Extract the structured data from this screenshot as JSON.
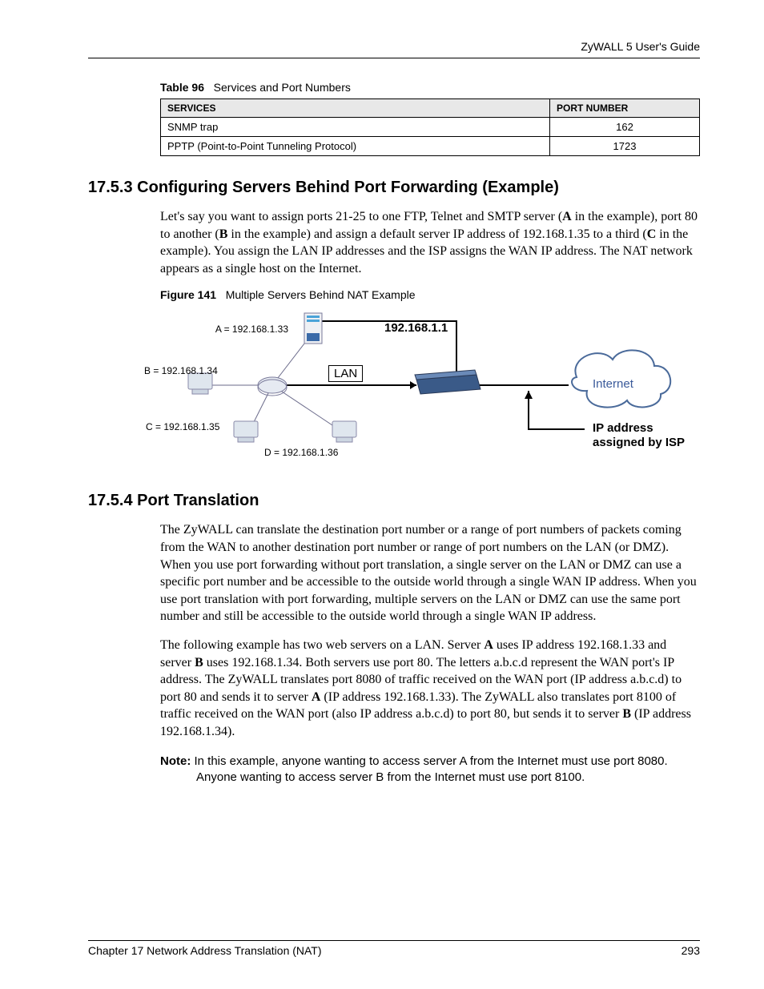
{
  "header": {
    "guide_title": "ZyWALL 5 User's Guide"
  },
  "table96": {
    "caption_label": "Table 96",
    "caption_text": "Services and Port Numbers",
    "columns": {
      "services": "SERVICES",
      "port": "PORT NUMBER"
    },
    "rows": [
      {
        "service": "SNMP trap",
        "port": "162"
      },
      {
        "service": "PPTP (Point-to-Point Tunneling Protocol)",
        "port": "1723"
      }
    ]
  },
  "section_1753": {
    "heading": "17.5.3  Configuring Servers Behind Port Forwarding (Example)",
    "para_parts": {
      "t1": "Let's say you want to assign ports 21-25 to one FTP, Telnet and SMTP server (",
      "A": "A",
      "t2": " in the example), port 80 to another (",
      "B": "B",
      "t3": " in the example) and assign a default server IP address of 192.168.1.35 to a third (",
      "C": "C",
      "t4": " in the example). You assign the LAN IP addresses and the ISP assigns the WAN IP address. The NAT network appears as a single host on the Internet."
    }
  },
  "figure141": {
    "caption_label": "Figure 141",
    "caption_text": "Multiple Servers Behind NAT Example",
    "labels": {
      "A": "A = 192.168.1.33",
      "B": "B = 192.168.1.34",
      "C": "C  = 192.168.1.35",
      "D": "D = 192.168.1.36",
      "gateway": "192.168.1.1",
      "lan": "LAN",
      "internet": "Internet",
      "isp1": "IP address",
      "isp2": "assigned by ISP"
    }
  },
  "section_1754": {
    "heading": "17.5.4  Port Translation",
    "para1": "The ZyWALL can translate the destination port number or a range of port numbers of packets coming from the WAN to another destination port number or range of port numbers on the LAN (or DMZ). When you use port forwarding without port translation, a single server on the LAN or DMZ can use a specific port number and be accessible to the outside world through a single WAN IP address. When you use port translation with port forwarding, multiple servers on the LAN or DMZ can use the same port number and still be accessible to the outside world through a single WAN IP address.",
    "para2_parts": {
      "t1": "The following example has two web servers on a LAN. Server ",
      "A": "A",
      "t2": " uses IP address 192.168.1.33 and server ",
      "B": "B",
      "t3": " uses 192.168.1.34. Both servers use port 80. The letters a.b.c.d represent the WAN port's IP address. The ZyWALL translates port 8080 of traffic received on the WAN port (IP address a.b.c.d) to port 80 and sends it to server ",
      "A2": "A",
      "t4": " (IP address 192.168.1.33). The ZyWALL also translates port 8100 of traffic received on the WAN port (also IP address a.b.c.d) to port 80, but sends it to server ",
      "B2": "B",
      "t5": " (IP address 192.168.1.34)."
    },
    "note_label": "Note:",
    "note_text": " In this example, anyone wanting to access server A from the Internet must use port 8080. Anyone wanting to access server B from the Internet must use port 8100."
  },
  "footer": {
    "chapter": "Chapter 17 Network Address Translation (NAT)",
    "page": "293"
  }
}
